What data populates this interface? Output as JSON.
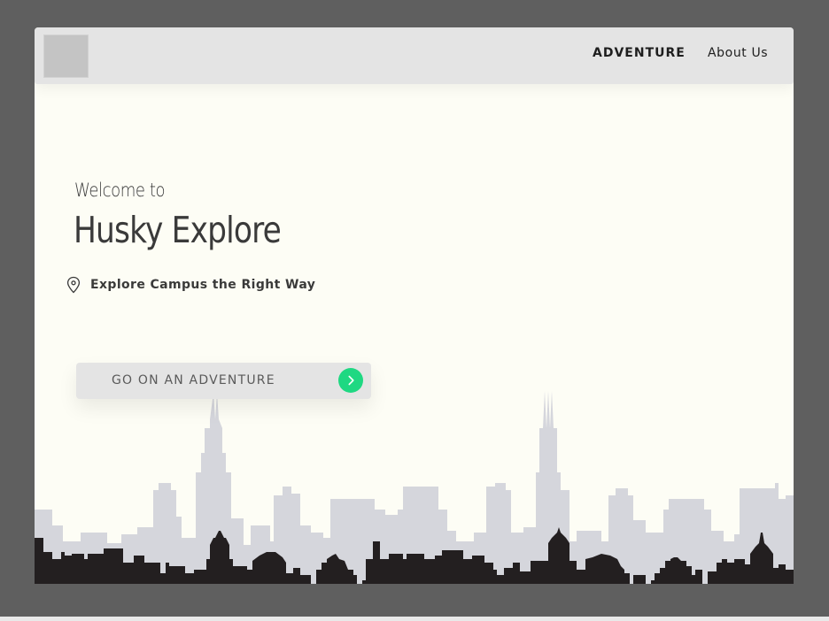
{
  "nav": {
    "adventure_label": "ADVENTURE",
    "about_label": "About Us"
  },
  "hero": {
    "welcome": "Welcome to",
    "title": "Husky Explore",
    "tagline": "Explore Campus the Right Way",
    "cta_label": "GO ON AN ADVENTURE"
  },
  "icons": {
    "location": "map-pin-icon",
    "cta_arrow": "chevron-right-icon"
  },
  "colors": {
    "page_background": "#fdfdf5",
    "nav_background": "#e4e4e4",
    "accent": "#1fd882",
    "skyline_back": "#d5d6dc",
    "skyline_front": "#231f20"
  }
}
